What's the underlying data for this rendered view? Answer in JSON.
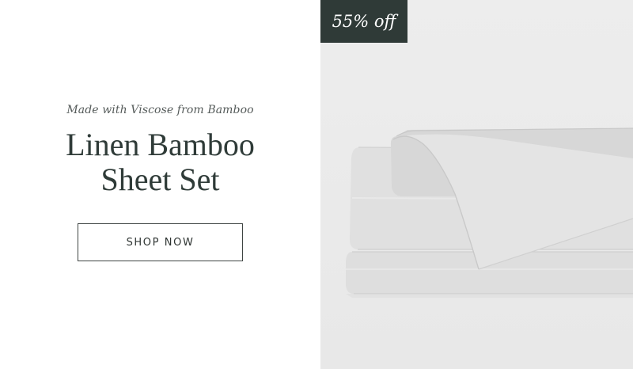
{
  "promo": {
    "eyebrow": "Made with Viscose from Bamboo",
    "title_line1": "Linen Bamboo",
    "title_line2": "Sheet Set",
    "cta_label": "SHOP NOW",
    "discount_badge": "55% off"
  },
  "colors": {
    "headline": "#2f3b38",
    "badge_bg": "#2f3a37",
    "panel_bg": "#ececec",
    "sheet": "#dcdcdc"
  },
  "image": {
    "subject-icon": "folded-sheet-set-icon"
  }
}
